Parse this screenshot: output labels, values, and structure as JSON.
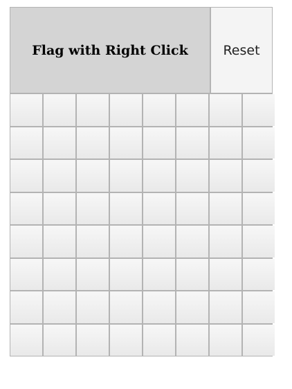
{
  "header": {
    "title": "Flag with Right Click",
    "reset_label": "Reset"
  },
  "board": {
    "rows": 8,
    "cols": 8
  },
  "colors": {
    "header_bg": "#d4d4d4",
    "cell_bg": "#f0f0f0",
    "border": "#b3b3b3"
  }
}
